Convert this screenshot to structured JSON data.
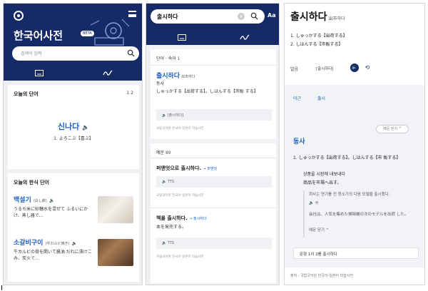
{
  "home": {
    "app_title": "한국어사전",
    "beta_badge": "BETA",
    "search_placeholder": "검색어 입력",
    "word_of_day": {
      "heading": "오늘의 단어",
      "pager": "1  2",
      "word": "신나다",
      "meaning": "1. よろこぶ【喜ぶ】"
    },
    "hanja": {
      "heading": "오늘의 한식 단어",
      "items": [
        {
          "word": "백설기",
          "hanja": "(白し餅)",
          "desc": "うるち米に砂糖水を混ぜて ふるいにかけ、蒸し器で…"
        },
        {
          "word": "소갈비구이",
          "hanja": "(牛カルビ焼き)",
          "desc": "牛カルビの骨を開いて醤油 だれに漬けこみ、炭火で…"
        }
      ]
    }
  },
  "search": {
    "query": "출시하다",
    "font_toggle": "Aa",
    "section_title": "단어 · 숙어",
    "section_count": "1",
    "entry": {
      "word": "출시하다",
      "hanja": "出市하다",
      "pos": "동사",
      "meaning": "しゅっかする【出荷する】。しはんする【市販 する】",
      "audio_label": "[출시하다]",
      "source": "국립국어원 한국어-일본어 학습사전"
    },
    "examples_title": "예문",
    "examples_count": "89",
    "examples": [
      {
        "text": "퍼앤엇으로 출시하다.",
        "link": "→ 퍼앤엇",
        "audio": "TTS",
        "source": "국립국어원 한국어-일본어 학습사전"
      },
      {
        "text": "책을 출시하다.",
        "link": "→ 출시하다",
        "translation": "本を発売する。",
        "audio": "TTS",
        "source": "국립국어원 한국어-일본어 학습사전"
      }
    ]
  },
  "detail": {
    "word": "출시하다",
    "hanja": "出市하다",
    "senses_summary": [
      "1. しゅっかする【出荷する】",
      "2. しはんする【市販する】"
    ],
    "pron_label": "발음",
    "pron_value": "[출시하다]",
    "tabs": [
      "어근",
      "출시"
    ],
    "fold_label": "예문 닫기 ^",
    "pos": "동사",
    "sense_text": "1. しゅっかする【出荷する】。しはんする【市 販する】",
    "ex_ko": "상품을 시장에 내보내다",
    "ex_ja": "商品を市場へ出す。",
    "example_box": [
      "회사는 연기를 전 청소기의 다음 모델을 출시했다.",
      "会社は、人気を集めた掃除機の次のモデルを出荷 した。",
      "예문 닫기 ^"
    ],
    "sentence_bar": "문형  1이 2를 출시하다",
    "footer": "출처 : 국립국어원 한국어-일본어 학습사전"
  }
}
